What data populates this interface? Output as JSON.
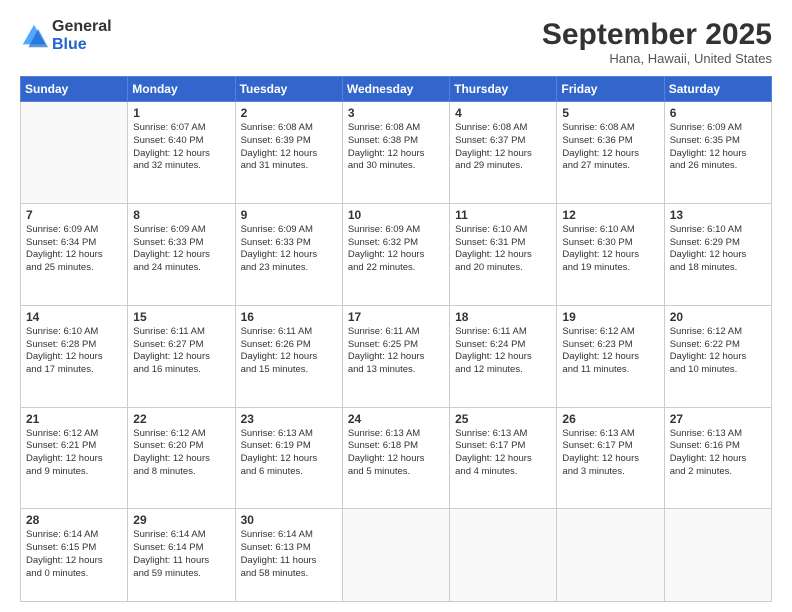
{
  "logo": {
    "general": "General",
    "blue": "Blue"
  },
  "header": {
    "month": "September 2025",
    "location": "Hana, Hawaii, United States"
  },
  "weekdays": [
    "Sunday",
    "Monday",
    "Tuesday",
    "Wednesday",
    "Thursday",
    "Friday",
    "Saturday"
  ],
  "weeks": [
    [
      {
        "day": "",
        "info": ""
      },
      {
        "day": "1",
        "info": "Sunrise: 6:07 AM\nSunset: 6:40 PM\nDaylight: 12 hours\nand 32 minutes."
      },
      {
        "day": "2",
        "info": "Sunrise: 6:08 AM\nSunset: 6:39 PM\nDaylight: 12 hours\nand 31 minutes."
      },
      {
        "day": "3",
        "info": "Sunrise: 6:08 AM\nSunset: 6:38 PM\nDaylight: 12 hours\nand 30 minutes."
      },
      {
        "day": "4",
        "info": "Sunrise: 6:08 AM\nSunset: 6:37 PM\nDaylight: 12 hours\nand 29 minutes."
      },
      {
        "day": "5",
        "info": "Sunrise: 6:08 AM\nSunset: 6:36 PM\nDaylight: 12 hours\nand 27 minutes."
      },
      {
        "day": "6",
        "info": "Sunrise: 6:09 AM\nSunset: 6:35 PM\nDaylight: 12 hours\nand 26 minutes."
      }
    ],
    [
      {
        "day": "7",
        "info": "Sunrise: 6:09 AM\nSunset: 6:34 PM\nDaylight: 12 hours\nand 25 minutes."
      },
      {
        "day": "8",
        "info": "Sunrise: 6:09 AM\nSunset: 6:33 PM\nDaylight: 12 hours\nand 24 minutes."
      },
      {
        "day": "9",
        "info": "Sunrise: 6:09 AM\nSunset: 6:33 PM\nDaylight: 12 hours\nand 23 minutes."
      },
      {
        "day": "10",
        "info": "Sunrise: 6:09 AM\nSunset: 6:32 PM\nDaylight: 12 hours\nand 22 minutes."
      },
      {
        "day": "11",
        "info": "Sunrise: 6:10 AM\nSunset: 6:31 PM\nDaylight: 12 hours\nand 20 minutes."
      },
      {
        "day": "12",
        "info": "Sunrise: 6:10 AM\nSunset: 6:30 PM\nDaylight: 12 hours\nand 19 minutes."
      },
      {
        "day": "13",
        "info": "Sunrise: 6:10 AM\nSunset: 6:29 PM\nDaylight: 12 hours\nand 18 minutes."
      }
    ],
    [
      {
        "day": "14",
        "info": "Sunrise: 6:10 AM\nSunset: 6:28 PM\nDaylight: 12 hours\nand 17 minutes."
      },
      {
        "day": "15",
        "info": "Sunrise: 6:11 AM\nSunset: 6:27 PM\nDaylight: 12 hours\nand 16 minutes."
      },
      {
        "day": "16",
        "info": "Sunrise: 6:11 AM\nSunset: 6:26 PM\nDaylight: 12 hours\nand 15 minutes."
      },
      {
        "day": "17",
        "info": "Sunrise: 6:11 AM\nSunset: 6:25 PM\nDaylight: 12 hours\nand 13 minutes."
      },
      {
        "day": "18",
        "info": "Sunrise: 6:11 AM\nSunset: 6:24 PM\nDaylight: 12 hours\nand 12 minutes."
      },
      {
        "day": "19",
        "info": "Sunrise: 6:12 AM\nSunset: 6:23 PM\nDaylight: 12 hours\nand 11 minutes."
      },
      {
        "day": "20",
        "info": "Sunrise: 6:12 AM\nSunset: 6:22 PM\nDaylight: 12 hours\nand 10 minutes."
      }
    ],
    [
      {
        "day": "21",
        "info": "Sunrise: 6:12 AM\nSunset: 6:21 PM\nDaylight: 12 hours\nand 9 minutes."
      },
      {
        "day": "22",
        "info": "Sunrise: 6:12 AM\nSunset: 6:20 PM\nDaylight: 12 hours\nand 8 minutes."
      },
      {
        "day": "23",
        "info": "Sunrise: 6:13 AM\nSunset: 6:19 PM\nDaylight: 12 hours\nand 6 minutes."
      },
      {
        "day": "24",
        "info": "Sunrise: 6:13 AM\nSunset: 6:18 PM\nDaylight: 12 hours\nand 5 minutes."
      },
      {
        "day": "25",
        "info": "Sunrise: 6:13 AM\nSunset: 6:17 PM\nDaylight: 12 hours\nand 4 minutes."
      },
      {
        "day": "26",
        "info": "Sunrise: 6:13 AM\nSunset: 6:17 PM\nDaylight: 12 hours\nand 3 minutes."
      },
      {
        "day": "27",
        "info": "Sunrise: 6:13 AM\nSunset: 6:16 PM\nDaylight: 12 hours\nand 2 minutes."
      }
    ],
    [
      {
        "day": "28",
        "info": "Sunrise: 6:14 AM\nSunset: 6:15 PM\nDaylight: 12 hours\nand 0 minutes."
      },
      {
        "day": "29",
        "info": "Sunrise: 6:14 AM\nSunset: 6:14 PM\nDaylight: 11 hours\nand 59 minutes."
      },
      {
        "day": "30",
        "info": "Sunrise: 6:14 AM\nSunset: 6:13 PM\nDaylight: 11 hours\nand 58 minutes."
      },
      {
        "day": "",
        "info": ""
      },
      {
        "day": "",
        "info": ""
      },
      {
        "day": "",
        "info": ""
      },
      {
        "day": "",
        "info": ""
      }
    ]
  ]
}
